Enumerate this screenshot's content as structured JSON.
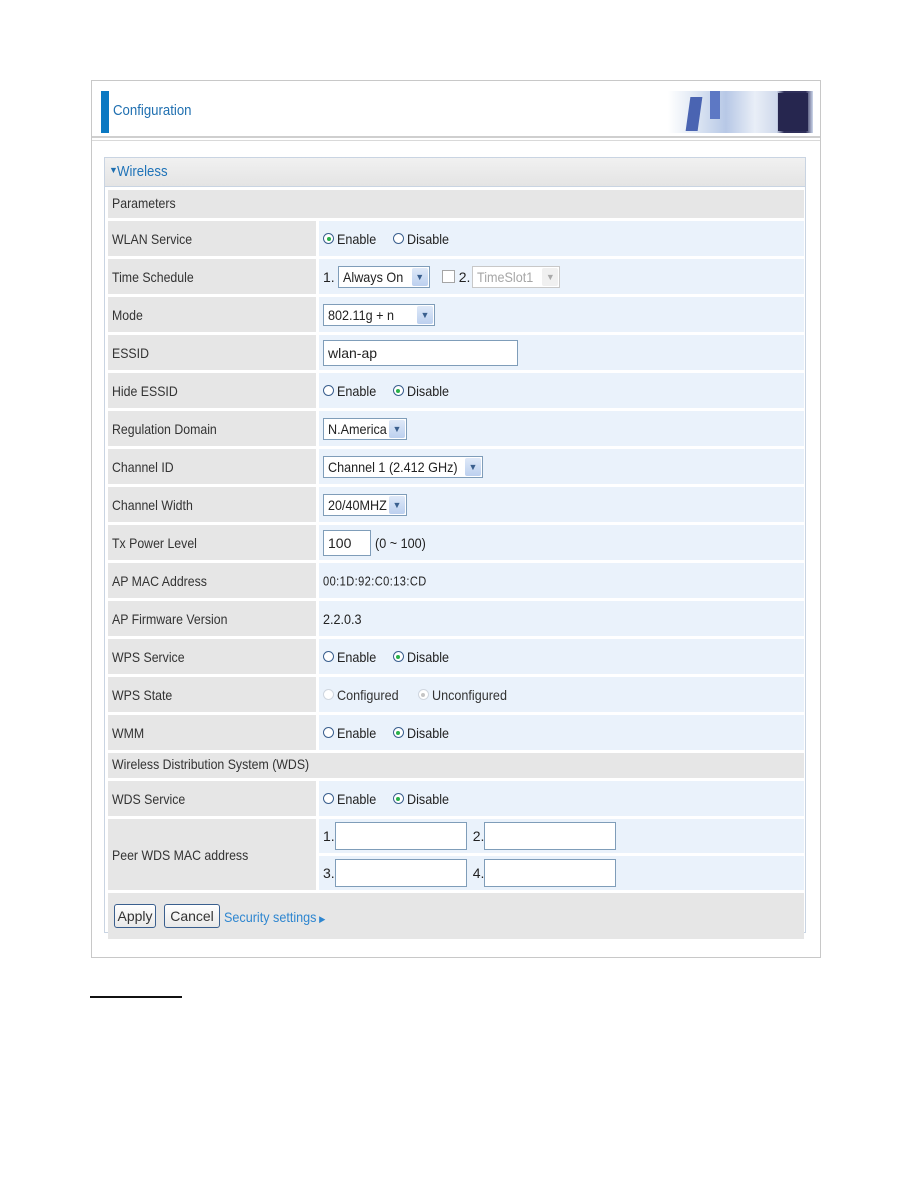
{
  "header": {
    "title": "Configuration",
    "image": "office-chairs-monitor-banner"
  },
  "section": {
    "title": "Wireless",
    "icon": "triangle-down-icon"
  },
  "parameters": {
    "heading": "Parameters",
    "wlan_service": {
      "label": "WLAN Service",
      "options": [
        "Enable",
        "Disable"
      ],
      "selected": "Enable"
    },
    "time_schedule": {
      "label": "Time Schedule",
      "slot1_prefix": "1.",
      "slot1_value": "Always On",
      "slot2_prefix": "2.",
      "slot2_value": "TimeSlot1",
      "slot2_checked": false
    },
    "mode": {
      "label": "Mode",
      "value": "802.11g + n"
    },
    "essid": {
      "label": "ESSID",
      "value": "wlan-ap"
    },
    "hide_essid": {
      "label": "Hide ESSID",
      "options": [
        "Enable",
        "Disable"
      ],
      "selected": "Disable"
    },
    "regulation_domain": {
      "label": "Regulation Domain",
      "value": "N.America"
    },
    "channel_id": {
      "label": "Channel ID",
      "value": "Channel 1 (2.412 GHz)"
    },
    "channel_width": {
      "label": "Channel Width",
      "value": "20/40MHZ"
    },
    "tx_power": {
      "label": "Tx Power Level",
      "value": "100",
      "hint": "(0 ~ 100)"
    },
    "ap_mac": {
      "label": "AP MAC Address",
      "value": "00:1D:92:C0:13:CD"
    },
    "ap_firmware": {
      "label": "AP Firmware Version",
      "value": "2.2.0.3"
    },
    "wps_service": {
      "label": "WPS Service",
      "options": [
        "Enable",
        "Disable"
      ],
      "selected": "Disable"
    },
    "wps_state": {
      "label": "WPS State",
      "options": [
        "Configured",
        "Unconfigured"
      ],
      "selected": "Unconfigured",
      "disabled": true
    },
    "wmm": {
      "label": "WMM",
      "options": [
        "Enable",
        "Disable"
      ],
      "selected": "Disable"
    }
  },
  "wds": {
    "heading": "Wireless Distribution System (WDS)",
    "service": {
      "label": "WDS Service",
      "options": [
        "Enable",
        "Disable"
      ],
      "selected": "Disable"
    },
    "peer": {
      "label": "Peer WDS MAC address",
      "prefixes": [
        "1.",
        "2.",
        "3.",
        "4."
      ],
      "values": [
        "",
        "",
        "",
        ""
      ]
    }
  },
  "actions": {
    "apply": "Apply",
    "cancel": "Cancel",
    "security_link": "Security settings",
    "link_icon": "triangle-right-icon"
  },
  "colors": {
    "accent": "#0a78c2",
    "label_bg": "#e6e6e6",
    "value_bg": "#eaf2fb",
    "link": "#2e86d0",
    "radio_on": "#29b14a"
  }
}
